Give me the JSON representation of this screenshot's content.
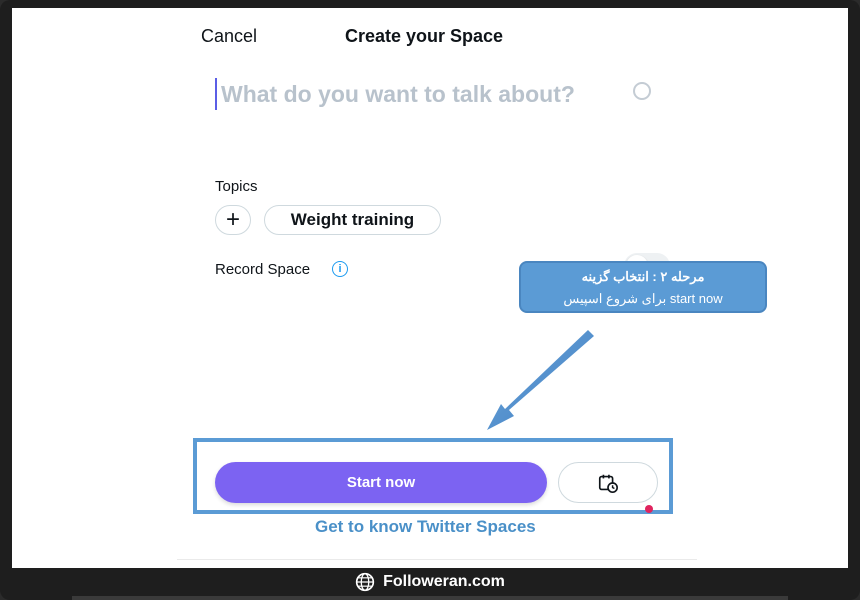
{
  "header": {
    "cancel_label": "Cancel",
    "title": "Create your Space"
  },
  "topic_input": {
    "placeholder": "What do you want to talk about?",
    "value": ""
  },
  "topics": {
    "label": "Topics",
    "items": [
      {
        "label": "Weight training"
      }
    ]
  },
  "record": {
    "label": "Record Space",
    "toggle_on": false
  },
  "callout": {
    "line1": "مرحله ۲ : انتخاب گزینه",
    "line2": "start now برای شروع اسپیس"
  },
  "actions": {
    "start_label": "Start now",
    "schedule_icon": "calendar-clock-icon"
  },
  "learn_link": "Get to know Twitter Spaces",
  "footer": {
    "brand": "Followeran.com",
    "icon": "globe-icon"
  },
  "colors": {
    "accent": "#7c63f2",
    "link": "#4a90c8",
    "callout": "#5b9bd5"
  }
}
